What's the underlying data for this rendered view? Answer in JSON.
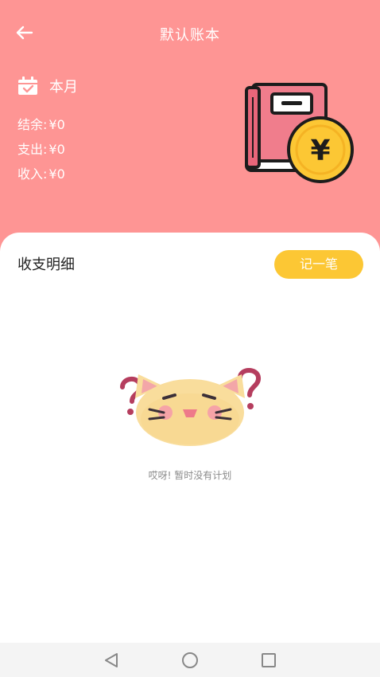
{
  "header": {
    "back_icon": "arrow-left-icon",
    "title": "默认账本",
    "bg_color": "#fe9594"
  },
  "summary": {
    "period_icon": "calendar-icon",
    "period_label": "本月",
    "balance_label": "结余:",
    "balance_value": "¥0",
    "expense_label": "支出:",
    "expense_value": "¥0",
    "income_label": "收入:",
    "income_value": "¥0"
  },
  "illustration": {
    "icon": "account-book-yen-icon",
    "yen_symbol": "¥"
  },
  "details": {
    "title": "收支明细",
    "record_button": "记一笔",
    "button_color": "#fcc734",
    "empty_icon": "confused-cat-icon",
    "empty_text": "哎呀!  暂时没有计划"
  },
  "system_nav": {
    "back_icon": "nav-back-triangle-icon",
    "home_icon": "nav-home-circle-icon",
    "recents_icon": "nav-recents-square-icon"
  }
}
